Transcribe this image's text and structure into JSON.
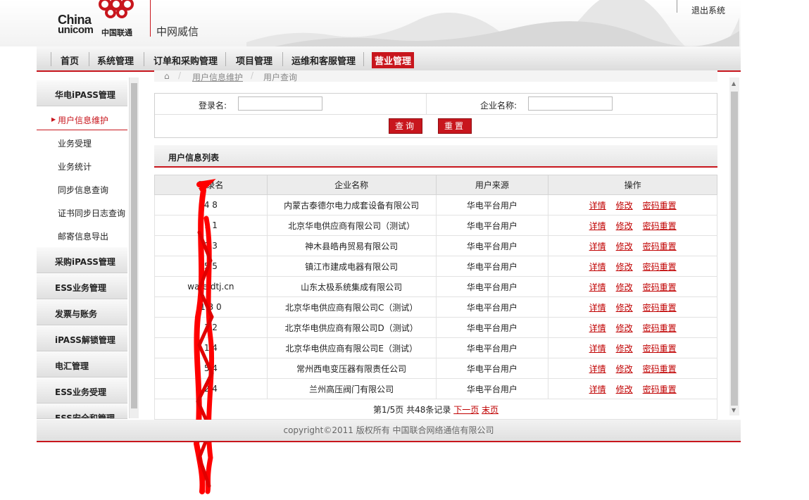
{
  "header": {
    "logo_line1": "China",
    "logo_line2": "unicom",
    "logo_cn": "中国联通",
    "brand": "中网威信",
    "logout": "退出系统"
  },
  "nav": [
    {
      "label": "首页"
    },
    {
      "label": "系统管理"
    },
    {
      "label": "订单和采购管理"
    },
    {
      "label": "项目管理"
    },
    {
      "label": "运维和客服管理"
    },
    {
      "label": "营业管理",
      "active": true
    }
  ],
  "sidebar": {
    "groups": [
      {
        "label": "华电iPASS管理"
      },
      {
        "label": "采购iPASS管理"
      },
      {
        "label": "ESS业务管理"
      },
      {
        "label": "发票与账务"
      },
      {
        "label": "iPASS解锁管理"
      },
      {
        "label": "电汇管理"
      },
      {
        "label": "ESS业务受理"
      },
      {
        "label": "ESS安全和管理"
      }
    ],
    "subitems": [
      {
        "label": "用户信息维护",
        "active": true
      },
      {
        "label": "业务受理"
      },
      {
        "label": "业务统计"
      },
      {
        "label": "同步信息查询"
      },
      {
        "label": "证书同步日志查询"
      },
      {
        "label": "邮寄信息导出"
      }
    ]
  },
  "breadcrumb": {
    "home_icon": "home-icon",
    "item1": "用户信息维护",
    "item2": "用户查询"
  },
  "search": {
    "login_label": "登录名:",
    "login_value": "",
    "company_label": "企业名称:",
    "company_value": "",
    "query_button": "查询",
    "reset_button": "重置"
  },
  "list": {
    "title": "用户信息列表",
    "columns": [
      "登录名",
      "企业名称",
      "用户来源",
      "操作"
    ],
    "rows": [
      {
        "login": "4    8",
        "company": "内蒙古泰德尔电力成套设备有限公司",
        "source": "华电平台用户"
      },
      {
        "login": "1   1",
        "company": "北京华电供应商有限公司（测试）",
        "source": "华电平台用户"
      },
      {
        "login": "2    3",
        "company": "神木县皓冉贸易有限公司",
        "source": "华电平台用户"
      },
      {
        "login": "5    5",
        "company": "镇江市建成电器有限公司",
        "source": "华电平台用户"
      },
      {
        "login": "wafe     dtj.cn",
        "company": "山东太极系统集成有限公司",
        "source": "华电平台用户"
      },
      {
        "login": "1   3  0",
        "company": "北京华电供应商有限公司C（测试）",
        "source": "华电平台用户"
      },
      {
        "login": "1    2",
        "company": "北京华电供应商有限公司D（测试）",
        "source": "华电平台用户"
      },
      {
        "login": "1    4",
        "company": "北京华电供应商有限公司E（测试）",
        "source": "华电平台用户"
      },
      {
        "login": "5    4",
        "company": "常州西电变压器有限责任公司",
        "source": "华电平台用户"
      },
      {
        "login": "2    4",
        "company": "兰州高压阀门有限公司",
        "source": "华电平台用户"
      }
    ],
    "ops": [
      "详情",
      "修改",
      "密码重置"
    ],
    "pager": {
      "summary": "第1/5页 共48条记录",
      "next": "下一页",
      "last": "末页"
    }
  },
  "footer": {
    "text": "copyright©2011 版权所有 中国联合网络通信有限公司"
  },
  "colors": {
    "accent": "#c8161d",
    "link": "#c00000"
  }
}
